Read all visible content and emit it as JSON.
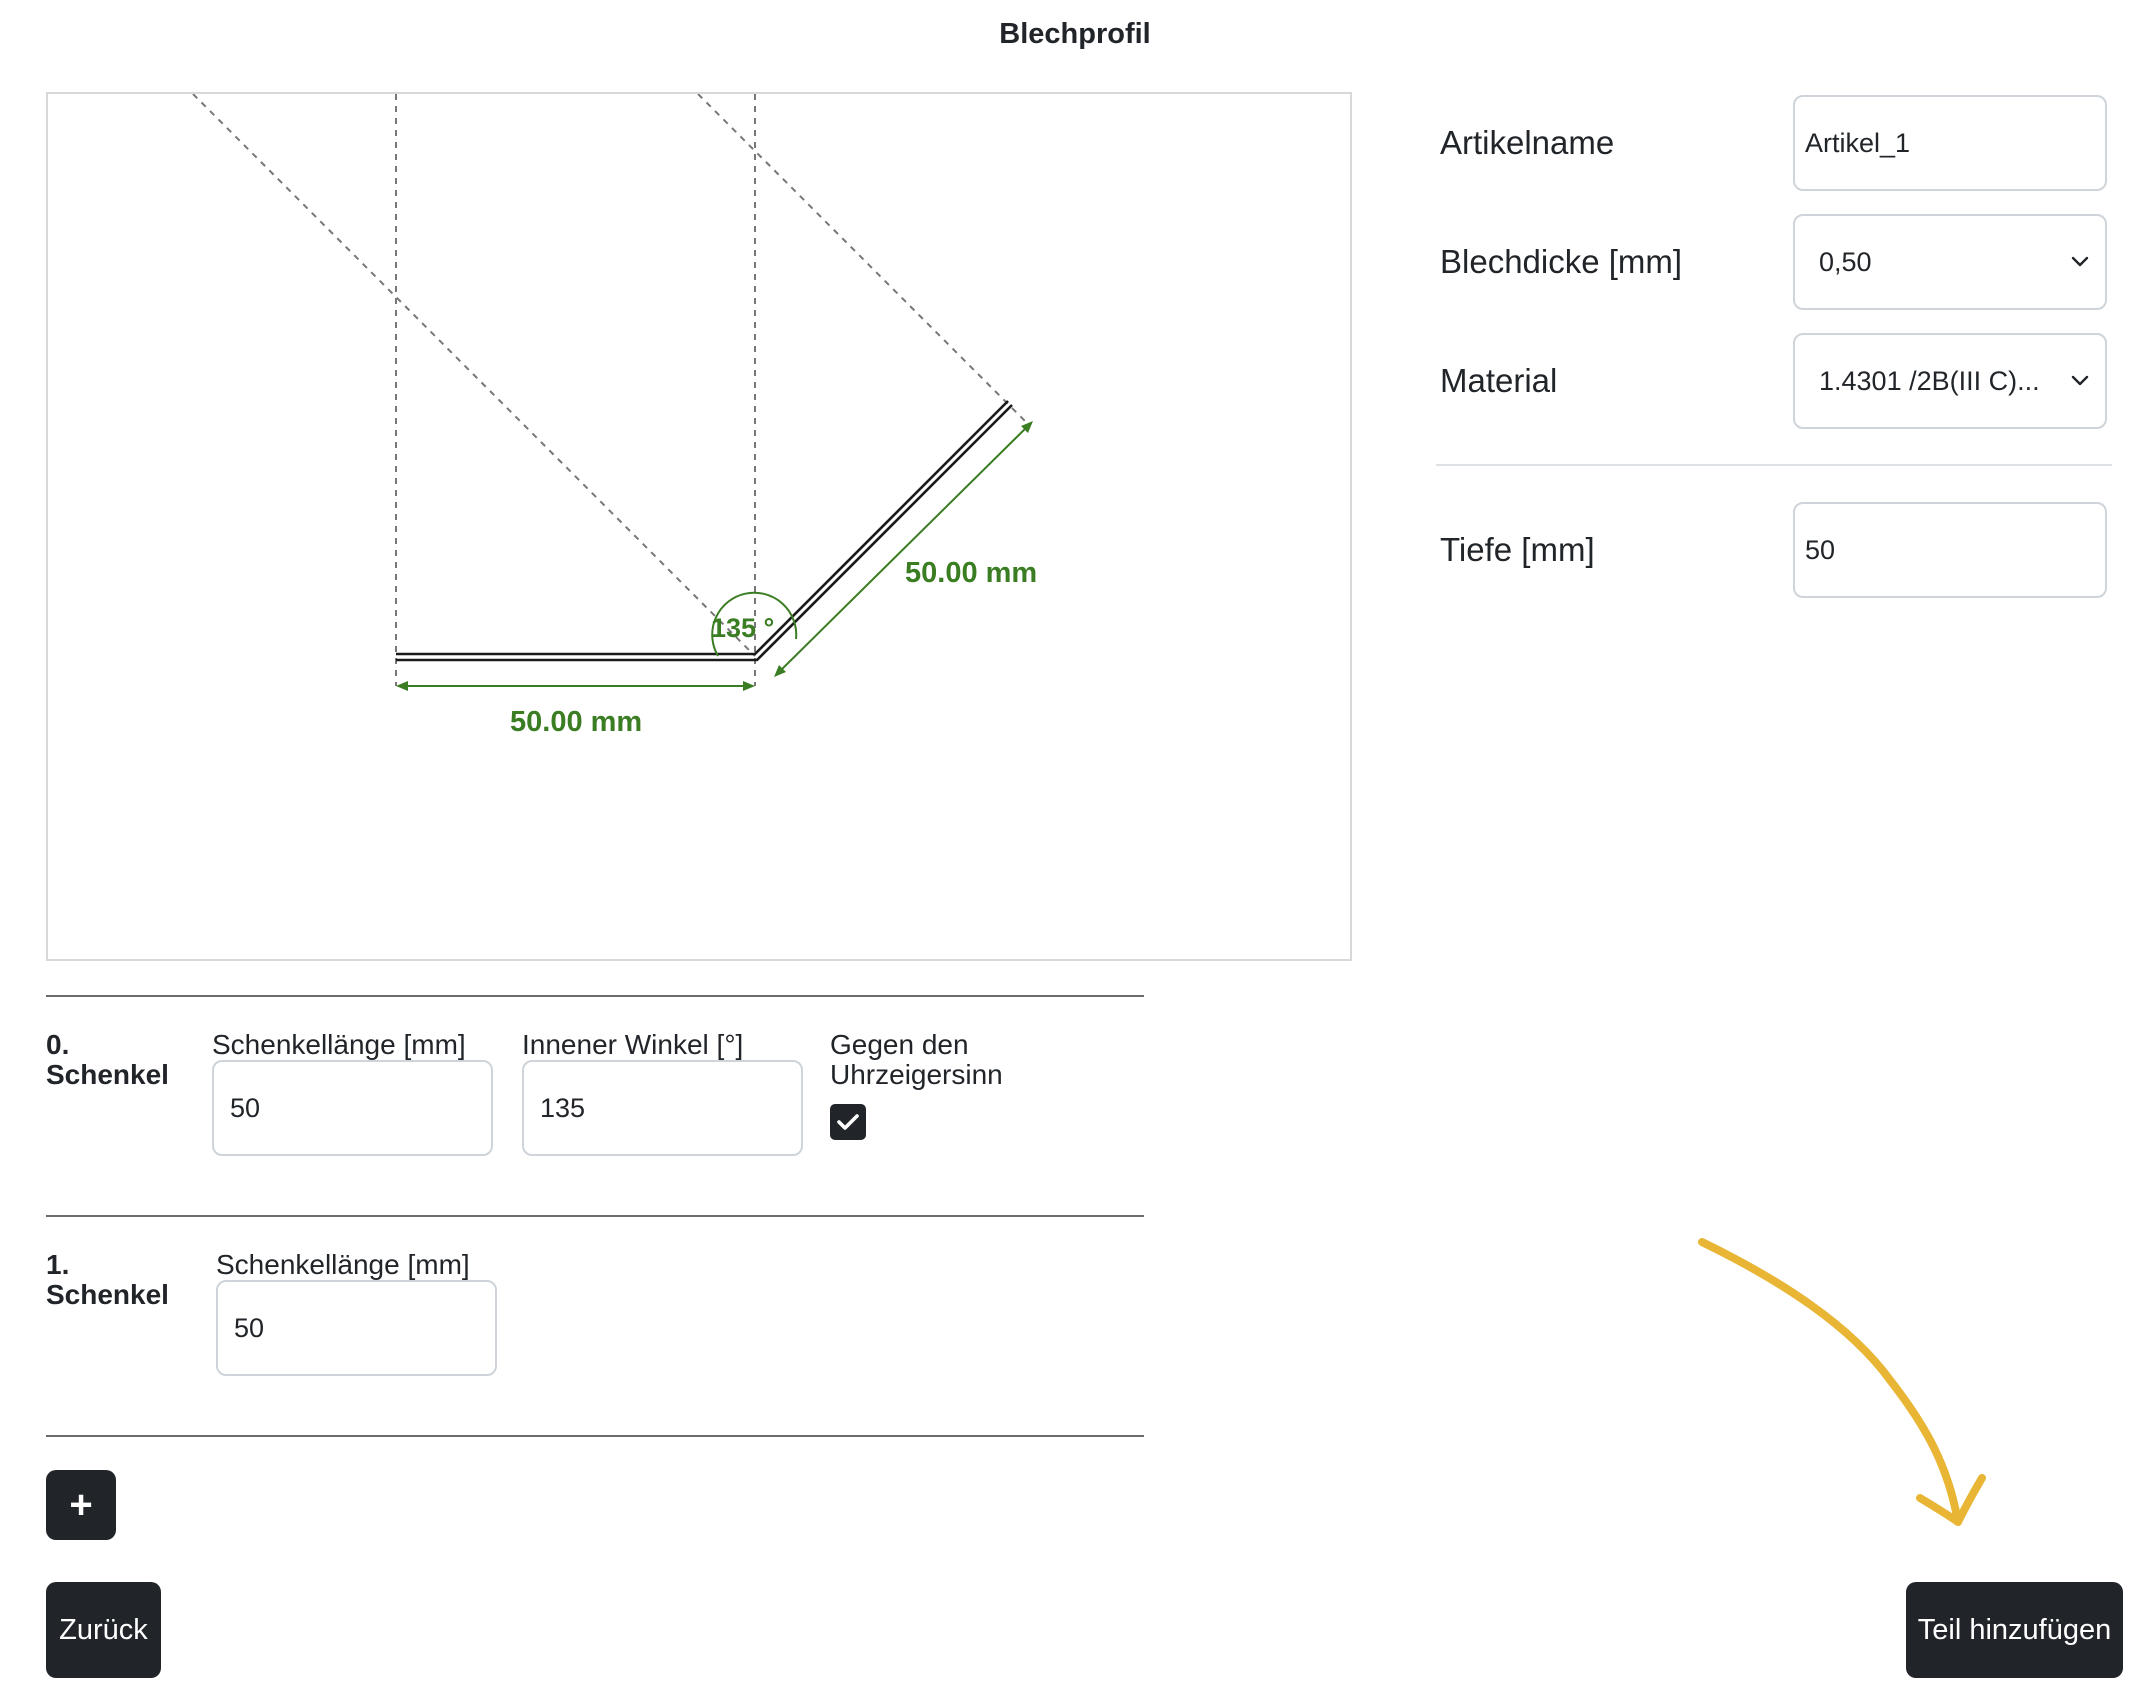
{
  "page": {
    "title": "Blechprofil"
  },
  "drawing": {
    "leg0_length_label": "50.00 mm",
    "leg1_length_label": "50.00 mm",
    "angle_label": "135 °",
    "colors": {
      "dimension": "#3b7d23",
      "profile": "#1a1a1a",
      "guide": "#777777"
    }
  },
  "form": {
    "artikelname": {
      "label": "Artikelname",
      "value": "Artikel_1"
    },
    "blechdicke": {
      "label": "Blechdicke [mm]",
      "value": "0,50"
    },
    "material": {
      "label": "Material",
      "value": "1.4301 /2B(III C)..."
    },
    "tiefe": {
      "label": "Tiefe [mm]",
      "value": "50"
    }
  },
  "schenkel": [
    {
      "title_line1": "0.",
      "title_line2": "Schenkel",
      "length_label": "Schenkellänge [mm]",
      "length_value": "50",
      "angle_label": "Innener Winkel [°]",
      "angle_value": "135",
      "ccw_label_line1": "Gegen den",
      "ccw_label_line2": "Uhrzeigersinn",
      "ccw_checked": true
    },
    {
      "title_line1": "1.",
      "title_line2": "Schenkel",
      "length_label": "Schenkellänge [mm]",
      "length_value": "50"
    }
  ],
  "buttons": {
    "add": "+",
    "back": "Zurück",
    "submit": "Teil hinzufügen"
  },
  "annotation": {
    "arrow_color": "#e8b634"
  }
}
